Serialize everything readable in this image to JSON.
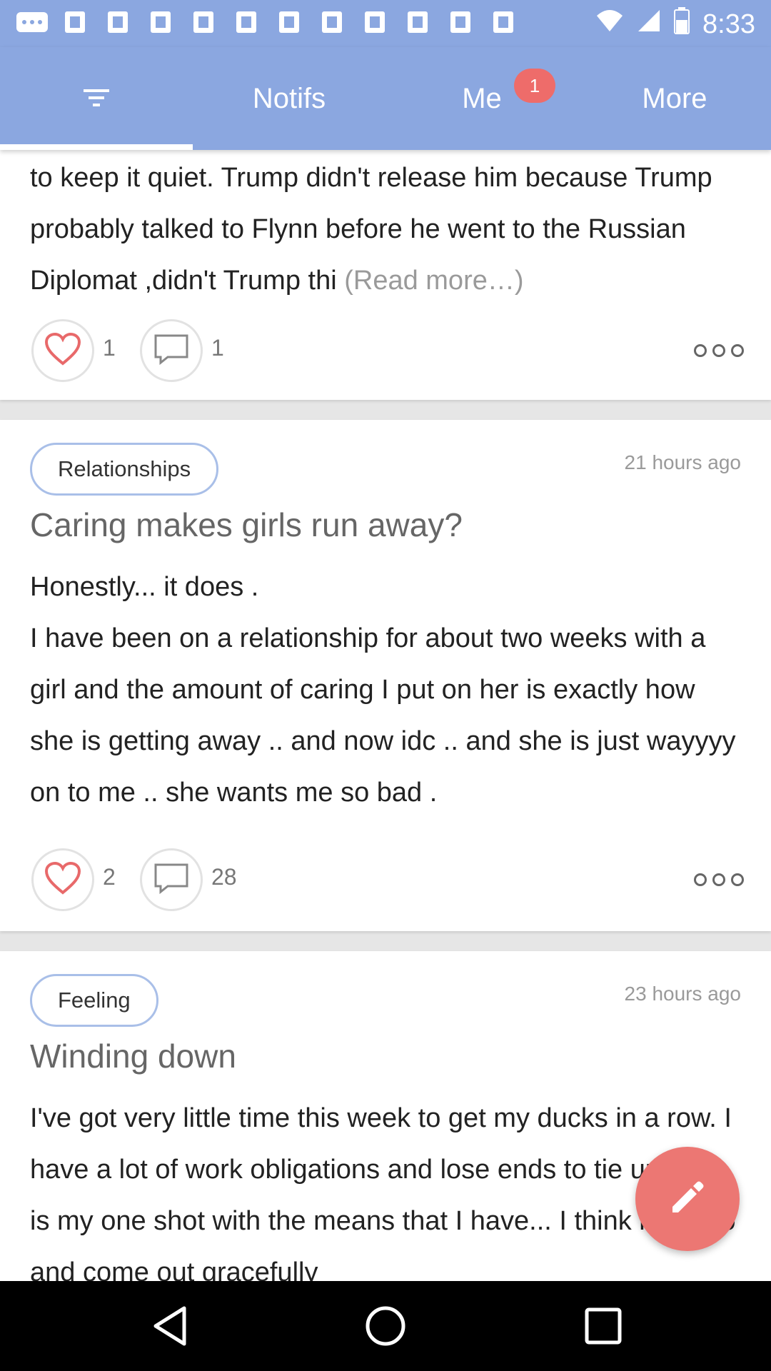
{
  "status_bar": {
    "time": "8:33",
    "notification_icons": [
      "chat-icon",
      "google-icon",
      "google-icon",
      "google-icon",
      "google-icon",
      "google-icon",
      "google-icon",
      "google-icon",
      "google-icon",
      "google-icon",
      "google-icon",
      "google-icon"
    ],
    "battery_level_percent": 60
  },
  "tabs": {
    "items": [
      {
        "label": "",
        "icon": "filter-icon",
        "active": true
      },
      {
        "label": "Notifs",
        "active": false
      },
      {
        "label": "Me",
        "active": false,
        "badge": "1"
      },
      {
        "label": "More",
        "active": false
      }
    ]
  },
  "posts": [
    {
      "body_partial": "to keep it quiet. Trump didn't release him because Trump probably talked to Flynn  before he went to the Russian Diplomat ,didn't Trump thi",
      "read_more": "(Read more…)",
      "likes": "1",
      "comments": "1"
    },
    {
      "tag": "Relationships",
      "time": "21 hours ago",
      "title": "Caring makes girls run away?",
      "body_line1": "Honestly... it does .",
      "body_rest": "I have been on a relationship for about two weeks with a girl and the amount of caring I put on her is exactly how she is getting away .. and now idc .. and she is just wayyyy on to me .. she wants me so bad .",
      "likes": "2",
      "comments": "28"
    },
    {
      "tag": "Feeling",
      "time": "23 hours ago",
      "title": "Winding down",
      "body": "I've got very little time this week to get my ducks in a row. I have a lot of work obligations and lose ends to tie up. This is my one shot with the means that I have... I think it will do and come out gracefully"
    }
  ],
  "colors": {
    "header": "#8ba7e0",
    "badge": "#ee6c6a",
    "heart": "#e8696a",
    "fab": "#ec7773",
    "tag_border": "#a9bfe8"
  }
}
